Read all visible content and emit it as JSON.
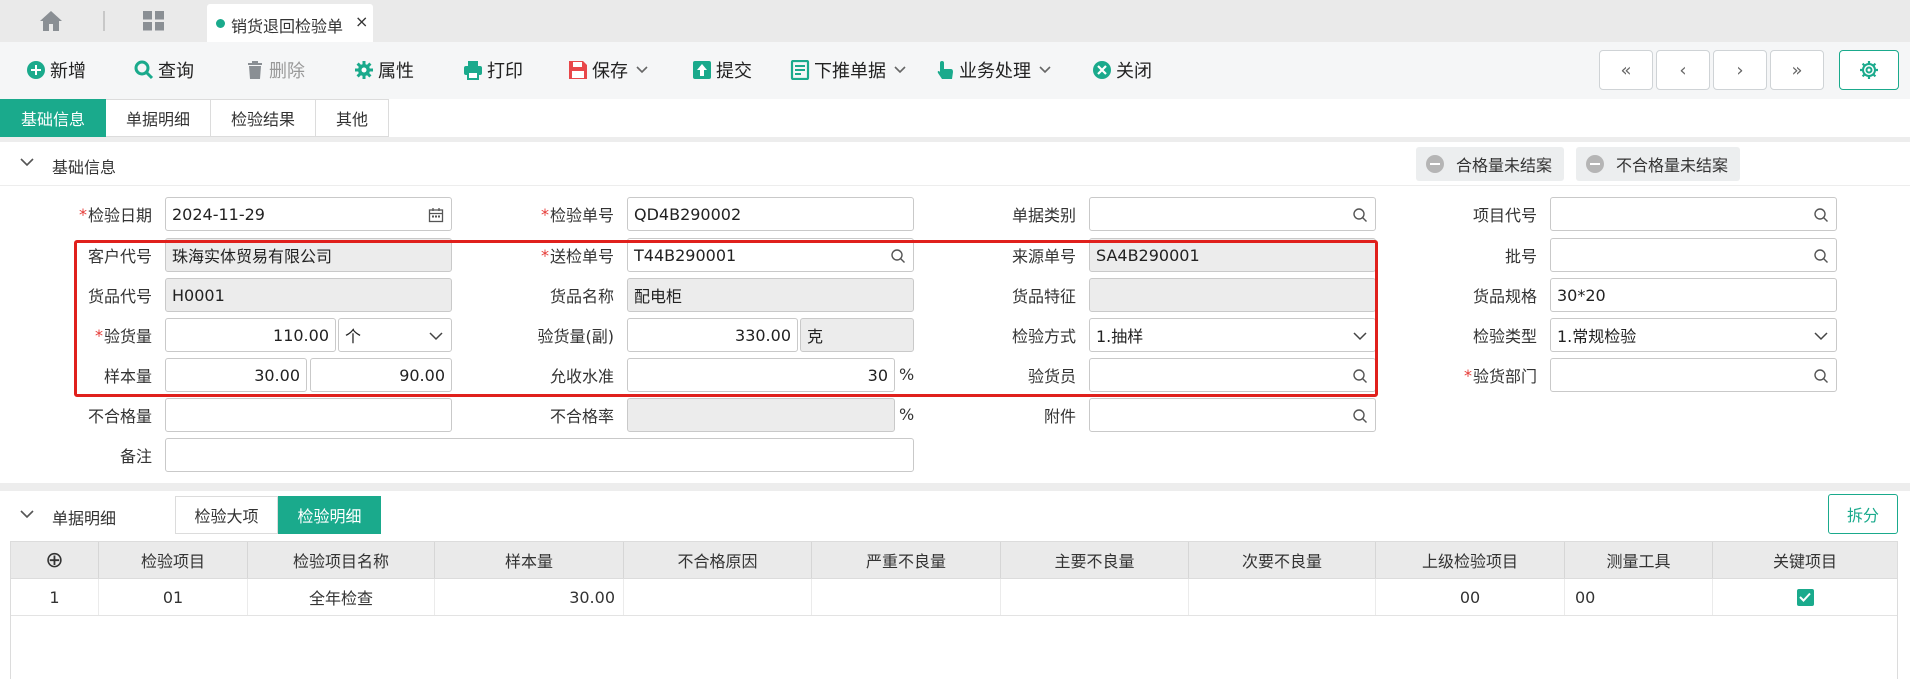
{
  "topbar": {
    "doc_tab_title": "销货退回检验单",
    "doc_tab_close": "×"
  },
  "toolbar": {
    "new_label": "新增",
    "query_label": "查询",
    "delete_label": "删除",
    "attr_label": "属性",
    "print_label": "打印",
    "save_label": "保存",
    "submit_label": "提交",
    "push_label": "下推单据",
    "business_label": "业务处理",
    "close_label": "关闭",
    "first_label": "«",
    "prev_label": "‹",
    "next_label": "›",
    "last_label": "»"
  },
  "section_tabs": [
    "基础信息",
    "单据明细",
    "检验结果",
    "其他"
  ],
  "basic": {
    "title": "基础信息",
    "status_pass": "合格量未结案",
    "status_fail": "不合格量未结案"
  },
  "form": {
    "inspect_date_label": "检验日期",
    "inspect_date_value": "2024-11-29",
    "inspect_no_label": "检验单号",
    "inspect_no_value": "QD4B290002",
    "doc_type_label": "单据类别",
    "doc_type_value": "",
    "project_code_label": "项目代号",
    "project_code_value": "",
    "customer_code_label": "客户代号",
    "customer_code_value": "珠海实体贸易有限公司",
    "send_no_label": "送检单号",
    "send_no_value": "T44B290001",
    "source_no_label": "来源单号",
    "source_no_value": "SA4B290001",
    "batch_label": "批号",
    "batch_value": "",
    "goods_code_label": "货品代号",
    "goods_code_value": "H0001",
    "goods_name_label": "货品名称",
    "goods_name_value": "配电柜",
    "goods_feature_label": "货品特征",
    "goods_feature_value": "",
    "goods_spec_label": "货品规格",
    "goods_spec_value": "30*20",
    "qty_label": "验货量",
    "qty_value": "110.00",
    "qty_unit": "个",
    "qty2_label": "验货量(副)",
    "qty2_value": "330.00",
    "qty2_unit": "克",
    "method_label": "检验方式",
    "method_value": "1.抽样",
    "type_label": "检验类型",
    "type_value": "1.常规检验",
    "sample_label": "样本量",
    "sample_value1": "30.00",
    "sample_value2": "90.00",
    "aql_label": "允收水准",
    "aql_value": "30",
    "aql_unit": "%",
    "inspector_label": "验货员",
    "inspector_value": "",
    "dept_label": "验货部门",
    "dept_value": "",
    "defect_qty_label": "不合格量",
    "defect_qty_value": "",
    "defect_rate_label": "不合格率",
    "defect_rate_value": "",
    "defect_rate_unit": "%",
    "attachment_label": "附件",
    "attachment_value": "",
    "remark_label": "备注",
    "remark_value": ""
  },
  "detail": {
    "title": "单据明细",
    "tab_major": "检验大项",
    "tab_detail": "检验明细",
    "split_label": "拆分",
    "add_label": "⊕",
    "columns": [
      "检验项目",
      "检验项目名称",
      "样本量",
      "不合格原因",
      "严重不良量",
      "主要不良量",
      "次要不良量",
      "上级检验项目",
      "测量工具",
      "关键项目"
    ],
    "rows": [
      [
        "1",
        "01",
        "全年检查",
        "30.00",
        "",
        "",
        "",
        "",
        "00",
        "00"
      ]
    ]
  },
  "colors": {
    "accent": "#1aaa8c",
    "highlight": "#e0201c"
  }
}
